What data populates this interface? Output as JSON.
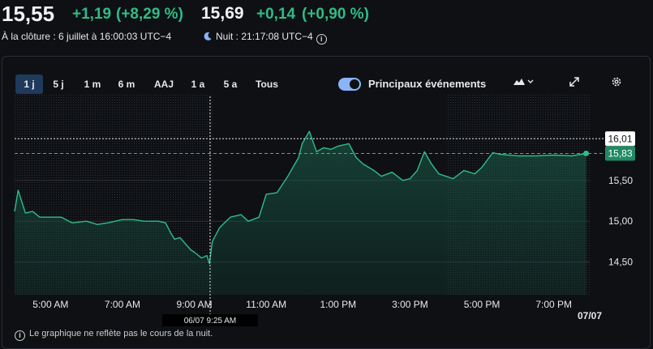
{
  "header": {
    "close_price": "15,55",
    "close_change": "+1,19",
    "close_change_pct": "(+8,29 %)",
    "ah_price": "15,69",
    "ah_change": "+0,14",
    "ah_change_pct": "(+0,90 %)",
    "close_label": "À la clôture : 6 juillet à 16:00:03 UTC−4",
    "night_label": "Nuit : 21:17:08 UTC−4"
  },
  "tabs": [
    {
      "label": "1 j",
      "active": true
    },
    {
      "label": "5 j"
    },
    {
      "label": "1 m"
    },
    {
      "label": "6 m"
    },
    {
      "label": "AAJ"
    },
    {
      "label": "1 a"
    },
    {
      "label": "5 a"
    },
    {
      "label": "Tous"
    }
  ],
  "events_toggle_label": "Principaux événements",
  "crosshair_label": "06/07 9:25 AM",
  "prev_close_label": "16,01",
  "current_label": "15,83",
  "date_label": "07/07",
  "footnote": "Le graphique ne reflète pas le cours de la nuit.",
  "colors": {
    "up": "#2ebd85",
    "accent": "#8ab4f8",
    "grid": "#2a2e35"
  },
  "chart_data": {
    "type": "area",
    "x_tick_labels": [
      "5:00 AM",
      "7:00 AM",
      "9:00 AM",
      "11:00 AM",
      "1:00 PM",
      "3:00 PM",
      "5:00 PM",
      "7:00 PM"
    ],
    "y_tick_labels": [
      "15,50",
      "15,00",
      "14,50"
    ],
    "y_ticks": [
      15.5,
      15.0,
      14.5
    ],
    "ylim": [
      14.1,
      16.35
    ],
    "xlim": [
      4.0,
      20.0
    ],
    "reference_lines": [
      16.01,
      15.83
    ],
    "x": [
      4.0,
      4.1,
      4.3,
      4.5,
      4.7,
      5.0,
      5.3,
      5.6,
      6.0,
      6.3,
      6.6,
      7.0,
      7.3,
      7.6,
      8.0,
      8.2,
      8.35,
      8.45,
      8.6,
      8.9,
      9.0,
      9.2,
      9.35,
      9.42,
      9.5,
      9.7,
      10.0,
      10.3,
      10.5,
      10.8,
      11.0,
      11.3,
      11.6,
      11.9,
      12.0,
      12.2,
      12.4,
      12.6,
      12.8,
      13.0,
      13.3,
      13.5,
      13.7,
      14.0,
      14.2,
      14.5,
      14.8,
      15.0,
      15.2,
      15.4,
      15.6,
      15.8,
      16.0,
      16.2,
      16.5,
      16.8,
      17.0,
      17.3,
      17.5,
      18.0,
      18.5,
      19.0,
      19.5,
      19.9
    ],
    "values": [
      15.12,
      15.38,
      15.1,
      15.12,
      15.05,
      15.05,
      15.05,
      14.98,
      15.0,
      14.96,
      14.98,
      15.02,
      15.02,
      15.0,
      15.0,
      14.98,
      14.85,
      14.78,
      14.8,
      14.65,
      14.62,
      14.55,
      14.58,
      14.48,
      14.75,
      14.92,
      15.05,
      15.08,
      15.0,
      15.05,
      15.33,
      15.35,
      15.55,
      15.78,
      15.95,
      16.1,
      15.85,
      15.9,
      15.88,
      15.92,
      15.95,
      15.78,
      15.7,
      15.62,
      15.55,
      15.6,
      15.5,
      15.52,
      15.62,
      15.85,
      15.7,
      15.58,
      15.55,
      15.52,
      15.62,
      15.58,
      15.66,
      15.84,
      15.82,
      15.8,
      15.8,
      15.81,
      15.8,
      15.83
    ]
  }
}
